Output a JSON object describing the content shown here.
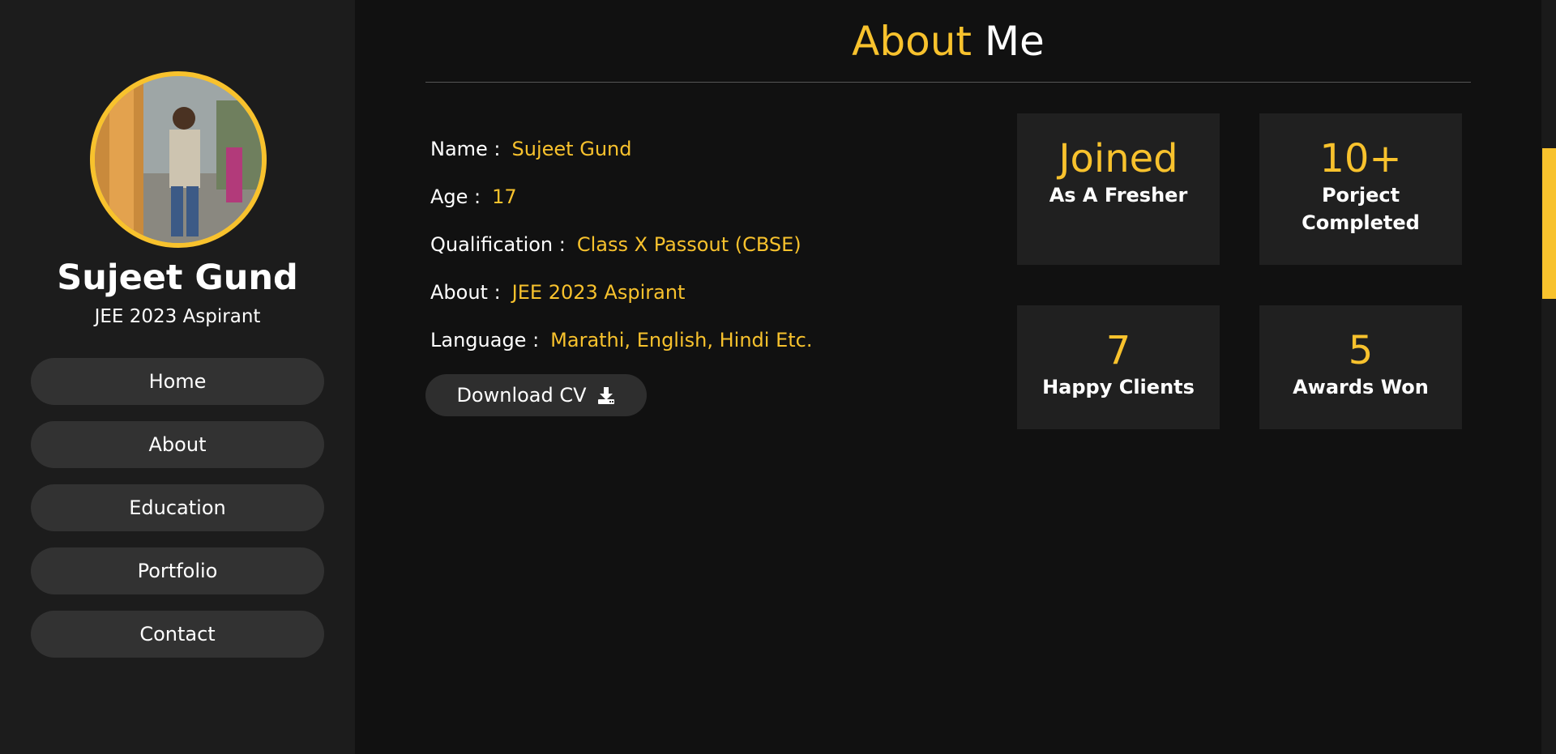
{
  "profile": {
    "name": "Sujeet Gund",
    "role": "JEE 2023 Aspirant"
  },
  "nav": {
    "items": [
      {
        "label": "Home"
      },
      {
        "label": "About"
      },
      {
        "label": "Education"
      },
      {
        "label": "Portfolio"
      },
      {
        "label": "Contact"
      }
    ]
  },
  "section": {
    "title_accent": "About",
    "title_rest": "Me"
  },
  "info": [
    {
      "label": "Name :",
      "value": "Sujeet Gund"
    },
    {
      "label": "Age :",
      "value": "17"
    },
    {
      "label": "Qualification :",
      "value": "Class X Passout (CBSE)"
    },
    {
      "label": "About :",
      "value": "JEE 2023 Aspirant"
    },
    {
      "label": "Language :",
      "value": "Marathi, English, Hindi Etc."
    }
  ],
  "cv_button": {
    "label": "Download CV",
    "icon": "download-icon"
  },
  "stats": [
    {
      "value": "Joined",
      "label_line1": "As A Fresher",
      "label_line2": ""
    },
    {
      "value": "10+",
      "label_line1": "Porject",
      "label_line2": "Completed"
    },
    {
      "value": "7",
      "label_line1": "Happy Clients",
      "label_line2": ""
    },
    {
      "value": "5",
      "label_line1": "Awards Won",
      "label_line2": ""
    }
  ],
  "colors": {
    "accent": "#f8c22d",
    "background": "#111111",
    "sidebar": "#1c1c1c",
    "button": "#323232",
    "card": "#202020"
  }
}
